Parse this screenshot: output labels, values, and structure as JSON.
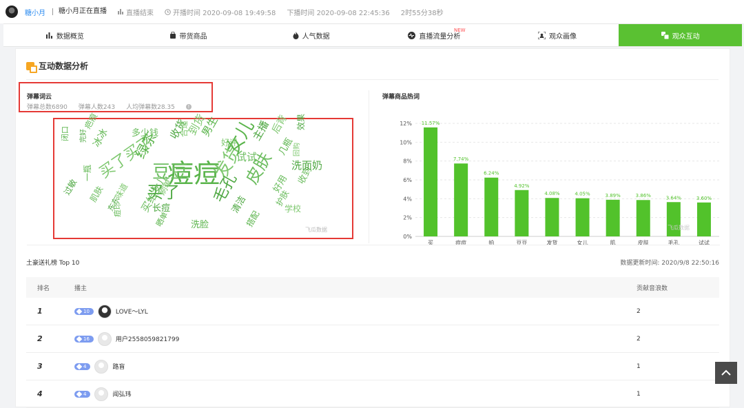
{
  "topbar": {
    "anchor": "糖小月",
    "live_status": "糖小月正在直播",
    "end_label": "直播结束",
    "start_time": "开播时间 2020-09-08 19:49:58",
    "end_time": "下播时间 2020-09-08 22:45:36",
    "duration": "2时55分38秒"
  },
  "tabs": [
    {
      "label": "数据概览",
      "icon": "bar-chart-icon"
    },
    {
      "label": "带货商品",
      "icon": "bag-icon"
    },
    {
      "label": "人气数据",
      "icon": "flame-icon"
    },
    {
      "label": "直播流量分析",
      "icon": "pulse-icon",
      "badge": "NEW"
    },
    {
      "label": "观众画像",
      "icon": "portrait-icon"
    },
    {
      "label": "观众互动",
      "icon": "interaction-icon",
      "active": true
    }
  ],
  "panel": {
    "title": "互动数据分析"
  },
  "wordcloud": {
    "title": "弹幕词云",
    "total": "弹幕总数6890",
    "people": "弹幕人数243",
    "avg": "人均弹幕数28.35",
    "words": [
      "痘痘",
      "豆豆",
      "买了",
      "发货",
      "女儿",
      "皮肤",
      "毛孔",
      "买了买了",
      "绿茶",
      "试试",
      "主播",
      "后背",
      "几瓶",
      "收到",
      "洗面奶",
      "学校",
      "洗脸",
      "买给女儿",
      "长痘",
      "味道",
      "冰冰",
      "多少钱",
      "收货",
      "到货",
      "男生",
      "好用",
      "清洁",
      "刷单",
      "搭配",
      "护肤",
      "效果",
      "回购",
      "一瓶",
      "肌肤",
      "东东",
      "合适",
      "晒单",
      "痘印",
      "完好",
      "好评",
      "闭口",
      "疤痕",
      "过敏"
    ],
    "watermark": "飞瓜数据"
  },
  "chart_data": {
    "type": "bar",
    "title": "弹幕商品热词",
    "categories": [
      "买",
      "痘痘",
      "拍",
      "豆豆",
      "发货",
      "女儿",
      "肌",
      "皮肤",
      "毛孔",
      "试试"
    ],
    "values": [
      11.57,
      7.74,
      6.24,
      4.92,
      4.08,
      4.05,
      3.89,
      3.86,
      3.64,
      3.6
    ],
    "data_labels": [
      "11.57%",
      "7.74%",
      "6.24%",
      "4.92%",
      "4.08%",
      "4.05%",
      "3.89%",
      "3.86%",
      "3.64%",
      "3.60%"
    ],
    "ylim": [
      0,
      12
    ],
    "yticks": [
      "0%",
      "2%",
      "4%",
      "6%",
      "8%",
      "10%",
      "12%"
    ],
    "grid": true,
    "color": "#52c22b",
    "watermark": "飞瓜数据"
  },
  "gifts": {
    "title": "土豪送礼榜 Top 10",
    "update": "数据更新时间: 2020/9/8 22:50:16",
    "headers": {
      "rank": "排名",
      "host": "播主",
      "value": "贡献音浪数"
    },
    "rows": [
      {
        "rank": "1",
        "level": "10",
        "name": "LOVE～LYL",
        "value": "2"
      },
      {
        "rank": "2",
        "level": "16",
        "name": "用户2558059821799",
        "value": "2"
      },
      {
        "rank": "3",
        "level": "4",
        "name": "路盲",
        "value": "1"
      },
      {
        "rank": "4",
        "level": "4",
        "name": "闻弘玮",
        "value": "1"
      }
    ]
  },
  "colors": {
    "accent": "#5ac132",
    "highlight": "#e53935"
  }
}
